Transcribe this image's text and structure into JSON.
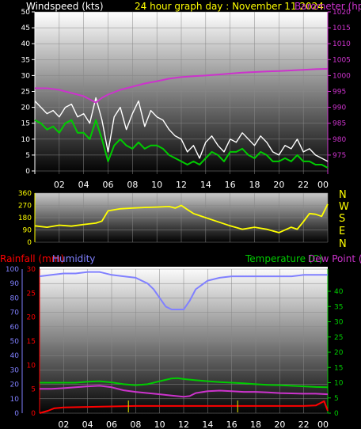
{
  "header": {
    "windspeed_label": "Windspeed (kts)",
    "title": "24 hour graph day : November 11 2024",
    "barometer_label": "Barometer (hpa)"
  },
  "colors": {
    "windspeed": "#ffffff",
    "windspeed_avg": "#00cc00",
    "barometer": "#cc33cc",
    "direction": "#ffff00",
    "rain": "#ff0000",
    "humidity": "#8080ff",
    "temperature": "#00cc00",
    "dewpoint": "#cc33cc",
    "title": "#ffff00"
  },
  "lower_header": {
    "rain_label": "Rainfall (mm)",
    "humidity_label": "Humidity",
    "temperature_label": "Temperature (C)",
    "dewpoint_label": "Dew Point (C)"
  },
  "compass": [
    "N",
    "W",
    "S",
    "E",
    "N"
  ],
  "chart_data": [
    {
      "type": "line",
      "name": "wind-and-barometer",
      "x_ticks": [
        "02",
        "04",
        "06",
        "08",
        "10",
        "12",
        "14",
        "16",
        "18",
        "20",
        "22",
        "00"
      ],
      "left_axis": {
        "label": "Windspeed (kts)",
        "ylim": [
          0,
          50
        ],
        "ticks": [
          0,
          5,
          10,
          15,
          20,
          25,
          30,
          35,
          40,
          45,
          50
        ]
      },
      "right_axis": {
        "label": "Barometer (hpa)",
        "ylim": [
          970,
          1020
        ],
        "ticks": [
          975,
          980,
          985,
          990,
          995,
          1000,
          1005,
          1010,
          1015,
          1020
        ]
      },
      "series": [
        {
          "name": "gust",
          "axis": "left",
          "x": [
            0,
            0.5,
            1,
            1.5,
            2,
            2.5,
            3,
            3.5,
            4,
            4.5,
            5,
            5.5,
            6,
            6.5,
            7,
            7.5,
            8,
            8.5,
            9,
            9.5,
            10,
            10.5,
            11,
            11.5,
            12,
            12.5,
            13,
            13.5,
            14,
            14.5,
            15,
            15.5,
            16,
            16.5,
            17,
            17.5,
            18,
            18.5,
            19,
            19.5,
            20,
            20.5,
            21,
            21.5,
            22,
            22.5,
            23,
            23.5,
            24
          ],
          "values": [
            22,
            20,
            18,
            19,
            17,
            20,
            21,
            17,
            18,
            15,
            23,
            16,
            6,
            17,
            20,
            13,
            18,
            22,
            14,
            19,
            17,
            16,
            13,
            11,
            10,
            6,
            8,
            4,
            9,
            11,
            8,
            6,
            10,
            9,
            12,
            10,
            8,
            11,
            9,
            6,
            5,
            8,
            7,
            10,
            6,
            7,
            5,
            4,
            3
          ]
        },
        {
          "name": "average",
          "axis": "left",
          "x": [
            0,
            0.5,
            1,
            1.5,
            2,
            2.5,
            3,
            3.5,
            4,
            4.5,
            5,
            5.5,
            6,
            6.5,
            7,
            7.5,
            8,
            8.5,
            9,
            9.5,
            10,
            10.5,
            11,
            11.5,
            12,
            12.5,
            13,
            13.5,
            14,
            14.5,
            15,
            15.5,
            16,
            16.5,
            17,
            17.5,
            18,
            18.5,
            19,
            19.5,
            20,
            20.5,
            21,
            21.5,
            22,
            22.5,
            23,
            23.5,
            24
          ],
          "values": [
            16,
            15,
            13,
            14,
            12,
            15,
            16,
            12,
            12,
            10,
            16,
            10,
            3,
            8,
            10,
            8,
            7,
            9,
            7,
            8,
            8,
            7,
            5,
            4,
            3,
            2,
            3,
            2,
            4,
            6,
            5,
            3,
            6,
            6,
            7,
            5,
            4,
            6,
            5,
            3,
            3,
            4,
            3,
            5,
            3,
            3,
            2,
            2,
            1
          ]
        },
        {
          "name": "barometer",
          "axis": "right",
          "x": [
            0,
            1,
            2,
            3,
            4,
            4.5,
            5,
            5.5,
            6,
            7,
            8,
            9,
            10,
            11,
            12,
            13,
            14,
            15,
            16,
            17,
            18,
            19,
            20,
            21,
            22,
            23,
            24
          ],
          "values": [
            996,
            996,
            995.5,
            994.5,
            993.5,
            992.5,
            991.5,
            993,
            994,
            995.5,
            996.5,
            997.5,
            998.2,
            999,
            999.5,
            999.8,
            1000,
            1000.3,
            1000.6,
            1000.9,
            1001.1,
            1001.3,
            1001.4,
            1001.6,
            1001.8,
            1002,
            1002.1
          ]
        }
      ]
    },
    {
      "type": "line",
      "name": "wind-direction",
      "left_axis": {
        "ylim": [
          0,
          360
        ],
        "ticks": [
          0,
          90,
          180,
          270,
          360
        ]
      },
      "series": [
        {
          "name": "direction",
          "x": [
            0,
            1,
            2,
            3,
            4,
            5,
            5.5,
            6,
            7,
            8,
            9,
            10,
            11,
            11.5,
            12,
            12.5,
            13,
            14,
            15,
            16,
            17,
            18,
            19,
            20,
            21,
            21.5,
            22,
            22.5,
            23,
            23.5,
            24
          ],
          "values": [
            120,
            110,
            125,
            118,
            130,
            140,
            155,
            230,
            245,
            250,
            255,
            258,
            262,
            250,
            270,
            240,
            210,
            180,
            150,
            120,
            95,
            110,
            95,
            70,
            110,
            95,
            150,
            210,
            205,
            190,
            280
          ]
        }
      ]
    },
    {
      "type": "line",
      "name": "rain-humidity-temperature",
      "x_ticks": [
        "02",
        "04",
        "06",
        "08",
        "10",
        "12",
        "14",
        "16",
        "18",
        "20",
        "22",
        "00"
      ],
      "left_axes": [
        {
          "label": "Rainfall (mm)",
          "ylim": [
            0,
            30
          ],
          "ticks": [
            0,
            5,
            10,
            15,
            20,
            25,
            30
          ]
        },
        {
          "label": "Humidity",
          "ylim": [
            0,
            100
          ],
          "ticks": [
            0,
            10,
            20,
            30,
            40,
            50,
            60,
            70,
            80,
            90,
            100
          ]
        }
      ],
      "right_axis": {
        "label": "Temperature (C)",
        "ylim": [
          0,
          40
        ],
        "ticks": [
          0,
          5,
          10,
          15,
          20,
          25,
          30,
          35,
          40
        ]
      },
      "series": [
        {
          "name": "Humidity",
          "axis": "humidity",
          "x": [
            0,
            1,
            2,
            3,
            4,
            5,
            6,
            7,
            8,
            9,
            9.5,
            10,
            10.5,
            11,
            11.5,
            12,
            12.5,
            13,
            14,
            15,
            16,
            17,
            18,
            19,
            20,
            21,
            22,
            23,
            24
          ],
          "values": [
            95,
            96,
            97,
            97,
            98,
            98,
            96,
            95,
            94,
            90,
            86,
            80,
            74,
            72,
            72,
            72,
            78,
            86,
            92,
            94,
            95,
            95,
            95,
            95,
            95,
            95,
            96,
            96,
            96
          ]
        },
        {
          "name": "Temperature (C)",
          "axis": "temp",
          "x": [
            0,
            1,
            2,
            3,
            4,
            5,
            6,
            7,
            8,
            9,
            10,
            11,
            11.5,
            12,
            13,
            14,
            15,
            16,
            17,
            18,
            19,
            20,
            21,
            22,
            23,
            24
          ],
          "values": [
            10,
            10,
            10,
            10,
            10.3,
            10.5,
            10.1,
            9.5,
            9.2,
            9.5,
            10.5,
            11.4,
            11.5,
            11.2,
            10.8,
            10.5,
            10.2,
            10,
            9.8,
            9.5,
            9.3,
            9.2,
            9,
            8.8,
            8.6,
            8.5
          ]
        },
        {
          "name": "Dew Point (C)",
          "axis": "temp",
          "x": [
            0,
            1,
            2,
            3,
            4,
            5,
            6,
            7,
            8,
            9,
            10,
            11,
            12,
            12.5,
            13,
            14,
            15,
            16,
            17,
            18,
            19,
            20,
            21,
            22,
            23,
            24
          ],
          "values": [
            8,
            8,
            8.2,
            8.5,
            8.8,
            9,
            8.5,
            7.5,
            7,
            6.6,
            6.2,
            5.8,
            5.4,
            5.6,
            6.6,
            7.2,
            7.4,
            7.2,
            7,
            7,
            6.8,
            6.6,
            6.5,
            6.4,
            6.4,
            6.2
          ]
        },
        {
          "name": "Rainfall (mm)",
          "axis": "rain",
          "x": [
            0,
            0.7,
            1.2,
            2,
            4,
            6,
            8,
            10,
            12,
            14,
            16,
            18,
            20,
            22,
            23,
            23.7,
            24
          ],
          "values": [
            0,
            0.5,
            1,
            1.2,
            1.3,
            1.4,
            1.5,
            1.5,
            1.5,
            1.5,
            1.5,
            1.5,
            1.5,
            1.5,
            1.6,
            2.5,
            0.5
          ]
        }
      ],
      "rain_rate_spikes": [
        7.4,
        16.5
      ]
    }
  ]
}
